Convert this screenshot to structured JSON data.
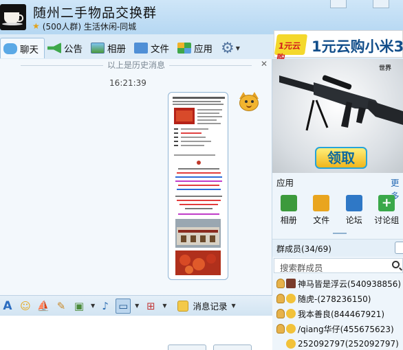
{
  "header": {
    "title": "随州二手物品交换群",
    "subtitle": "(500人群) 生活休闲-同城"
  },
  "tabs": [
    {
      "label": "聊天",
      "icon": "chat-icon"
    },
    {
      "label": "公告",
      "icon": "megaphone-icon"
    },
    {
      "label": "相册",
      "icon": "album-icon"
    },
    {
      "label": "文件",
      "icon": "folder-icon"
    },
    {
      "label": "应用",
      "icon": "apps-grid-icon"
    }
  ],
  "ad_top": {
    "badge": "1元云购",
    "text": "1元云购小米3"
  },
  "chat": {
    "history_label": "以上是历史消息",
    "timestamp": "16:21:39"
  },
  "toolbar": {
    "history_label": "消息记录"
  },
  "ad_game": {
    "world_label": "世界",
    "claim_label": "领取"
  },
  "apps": {
    "title": "应用",
    "more": "更多",
    "items": [
      {
        "label": "相册",
        "color": "#3c9a3c"
      },
      {
        "label": "文件",
        "color": "#e9a51f"
      },
      {
        "label": "论坛",
        "color": "#2f78c6"
      },
      {
        "label": "讨论组",
        "color": "#3aa84a"
      }
    ]
  },
  "members": {
    "title": "群成员(34/69)",
    "search_placeholder": "搜索群成员",
    "list": [
      {
        "name": "神马皆是浮云(540938856)"
      },
      {
        "name": "随虎-(278236150)"
      },
      {
        "name": "我本善良(844467921)"
      },
      {
        "name": "/qiang华仔(455675623)"
      },
      {
        "name": "252092797(252092797)"
      }
    ]
  }
}
